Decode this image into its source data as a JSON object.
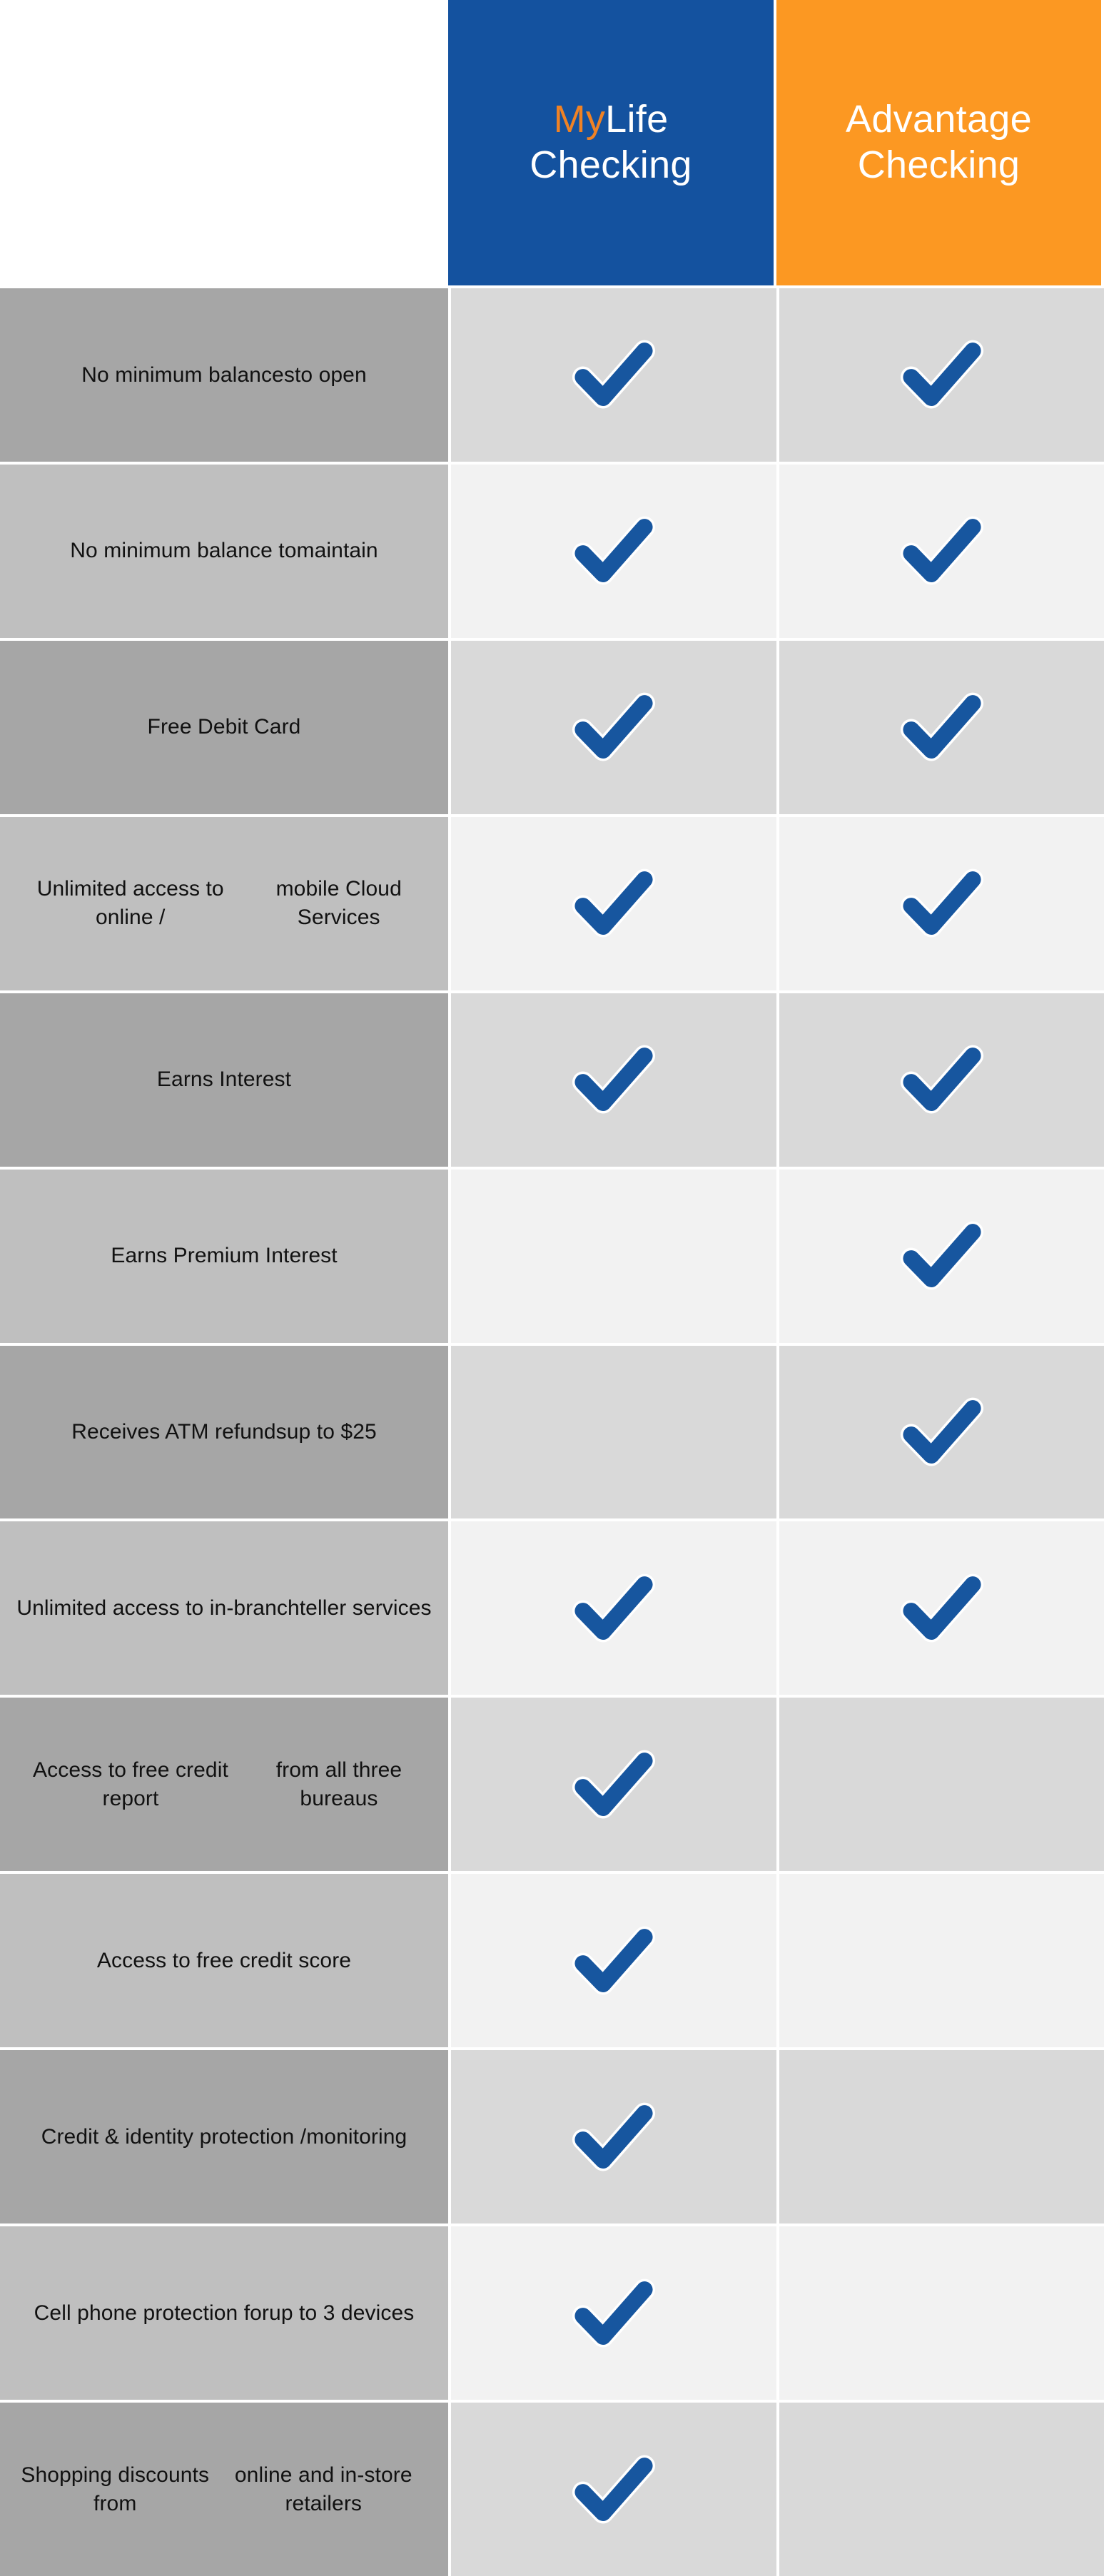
{
  "header": {
    "spacer_label": "",
    "columns": [
      {
        "id": "mylife",
        "brand_prefix": "My",
        "brand_suffix": "Life",
        "product_word": "Checking",
        "bg_color": "#14529F",
        "prefix_color": "#F08224",
        "text_color": "#FFFFFF"
      },
      {
        "id": "advantage",
        "name_line1": "Advantage",
        "name_line2": "Checking",
        "bg_color": "#FC9822",
        "text_color": "#FFFFFF"
      }
    ]
  },
  "colors": {
    "brand_blue": "#14529F",
    "brand_orange": "#FC9822",
    "check_blue": "#17569F",
    "label_dark": "#A6A6A6",
    "label_light": "#BFBFBF",
    "cell_dark": "#D9D9D9",
    "cell_light": "#F2F2F2"
  },
  "icons": {
    "check": "checkmark-icon"
  },
  "rows": [
    {
      "label_line1": "No minimum balances",
      "label_line2": "to open",
      "mylife": true,
      "advantage": true,
      "shade": "dark"
    },
    {
      "label_line1": "No minimum balance to",
      "label_line2": "maintain",
      "mylife": true,
      "advantage": true,
      "shade": "light"
    },
    {
      "label_line1": "Free Debit Card",
      "label_line2": "",
      "mylife": true,
      "advantage": true,
      "shade": "dark"
    },
    {
      "label_line1": "Unlimited access to online /",
      "label_line2": "mobile Cloud Services",
      "mylife": true,
      "advantage": true,
      "shade": "light"
    },
    {
      "label_line1": "Earns Interest",
      "label_line2": "",
      "mylife": true,
      "advantage": true,
      "shade": "dark"
    },
    {
      "label_line1": "Earns Premium Interest",
      "label_line2": "",
      "mylife": false,
      "advantage": true,
      "shade": "light"
    },
    {
      "label_line1": "Receives ATM refunds",
      "label_line2": "up to $25",
      "mylife": false,
      "advantage": true,
      "shade": "dark"
    },
    {
      "label_line1": "Unlimited access to in-branch",
      "label_line2": "teller services",
      "mylife": true,
      "advantage": true,
      "shade": "light"
    },
    {
      "label_line1": "Access to free credit report",
      "label_line2": "from all three bureaus",
      "mylife": true,
      "advantage": false,
      "shade": "dark"
    },
    {
      "label_line1": "Access to free credit score",
      "label_line2": "",
      "mylife": true,
      "advantage": false,
      "shade": "light"
    },
    {
      "label_line1": "Credit & identity protection /",
      "label_line2": "monitoring",
      "mylife": true,
      "advantage": false,
      "shade": "dark"
    },
    {
      "label_line1": "Cell phone protection for",
      "label_line2": "up to 3 devices",
      "mylife": true,
      "advantage": false,
      "shade": "light"
    },
    {
      "label_line1": "Shopping discounts from",
      "label_line2": "online and in-store retailers",
      "mylife": true,
      "advantage": false,
      "shade": "dark"
    }
  ]
}
